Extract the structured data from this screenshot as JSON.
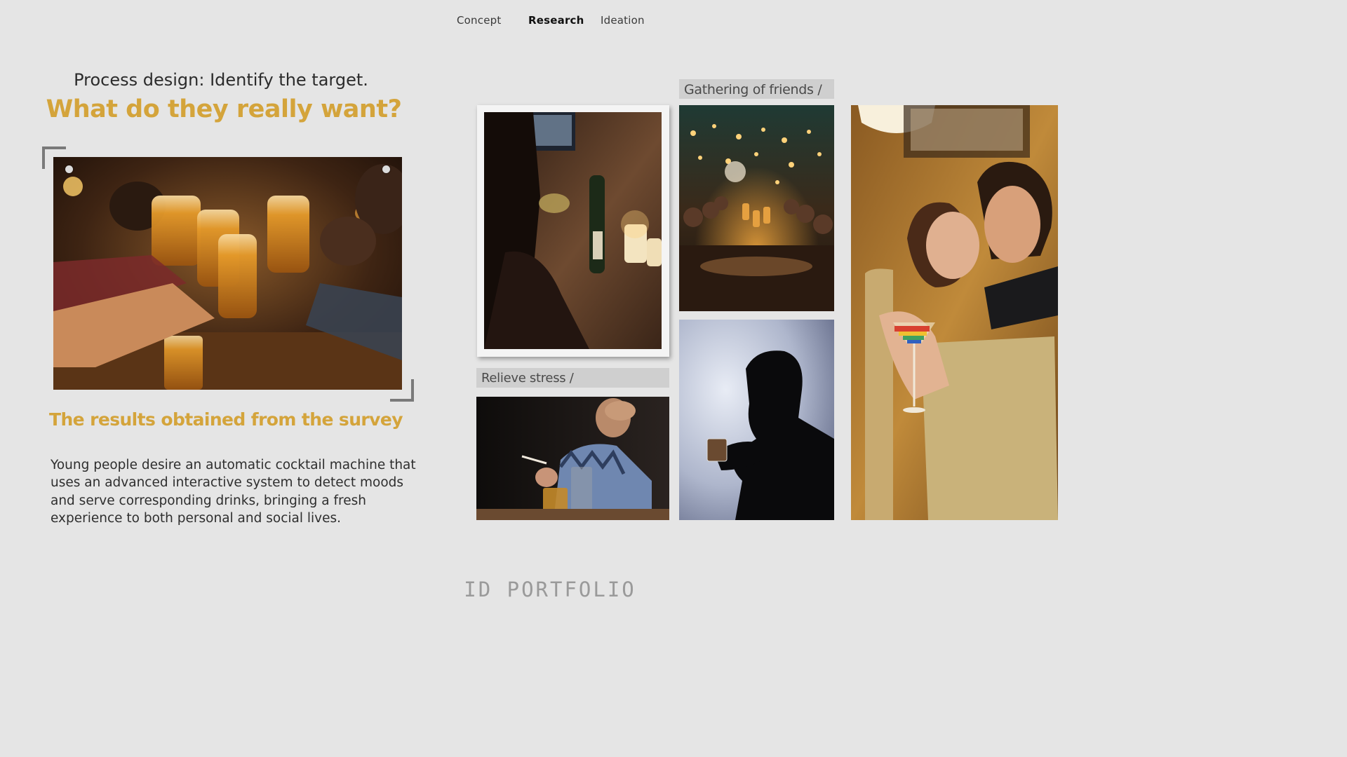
{
  "nav": {
    "items": [
      {
        "label": "Concept"
      },
      {
        "label": "Research"
      },
      {
        "label": "Ideation"
      }
    ],
    "active": "Research"
  },
  "heading": {
    "subtitle": "Process design: Identify the target.",
    "headline": "What do they really want?"
  },
  "survey": {
    "title": "The results obtained from the survey",
    "body": "Young people desire an automatic cocktail machine that uses an advanced interactive system to detect moods and serve corresponding drinks, bringing a fresh experience to both personal and social lives."
  },
  "moodboard": {
    "gathering_label": "Gathering of friends /",
    "stress_label": "Relieve stress /"
  },
  "footer": {
    "brand": "ID PORTFOLIO"
  },
  "colors": {
    "background": "#e5e5e5",
    "accent": "#d4a43b",
    "tag": "#cfcfcf"
  }
}
